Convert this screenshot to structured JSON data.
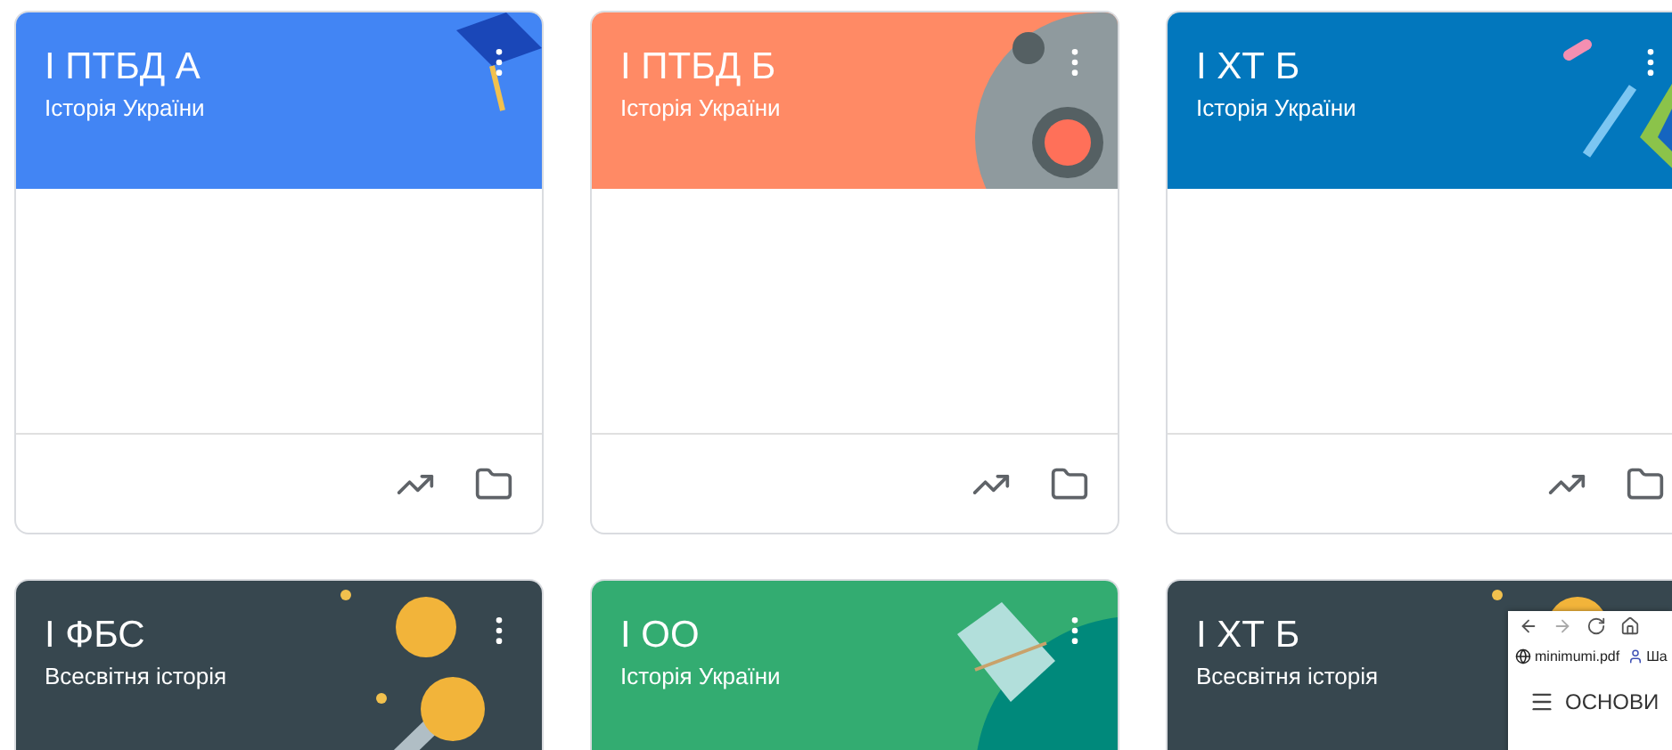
{
  "cards": [
    {
      "title": "I ПТБД А",
      "subtitle": "Історія України",
      "color": "#4285f4",
      "kind": "cap"
    },
    {
      "title": "I ПТБД Б",
      "subtitle": "Історія України",
      "color": "#ff8a65",
      "kind": "lens"
    },
    {
      "title": "I ХТ Б",
      "subtitle": "Історія України",
      "color": "#0277bd",
      "kind": "pen"
    },
    {
      "title": "I ФБС",
      "subtitle": "Всесвітня історія",
      "color": "#37474f",
      "kind": "coins"
    },
    {
      "title": "I ОО",
      "subtitle": "Історія України",
      "color": "#33ac71",
      "kind": "book"
    },
    {
      "title": "I ХТ Б",
      "subtitle": "Всесвітня історія",
      "color": "#37474f",
      "kind": "coins"
    }
  ],
  "popup": {
    "bookmarks": [
      {
        "kind": "globe",
        "label": "minimumi.pdf"
      },
      {
        "kind": "person",
        "label": "Ша"
      }
    ],
    "heading": "ОСНОВИ"
  }
}
